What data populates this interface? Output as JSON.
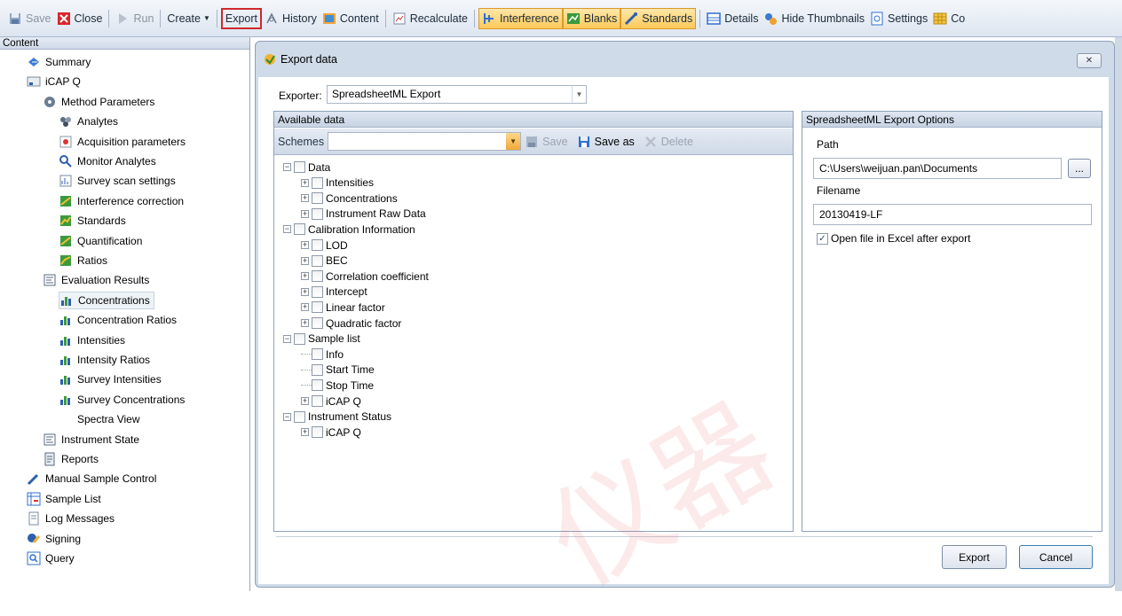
{
  "toolbar": {
    "save": "Save",
    "close": "Close",
    "run": "Run",
    "create": "Create",
    "export": "Export",
    "history": "History",
    "content": "Content",
    "recalculate": "Recalculate",
    "interference": "Interference",
    "blanks": "Blanks",
    "standards": "Standards",
    "details": "Details",
    "hide_thumbnails": "Hide Thumbnails",
    "settings": "Settings",
    "cut_off": "Co"
  },
  "left": {
    "header": "Content",
    "items": [
      {
        "label": "Summary",
        "icon": "summary-icon"
      },
      {
        "label": "iCAP Q",
        "icon": "instrument-icon"
      },
      {
        "label": "Method Parameters",
        "icon": "method-icon"
      },
      {
        "label": "Analytes",
        "icon": "analytes-icon"
      },
      {
        "label": "Acquisition parameters",
        "icon": "acquisition-icon"
      },
      {
        "label": "Monitor Analytes",
        "icon": "monitor-icon"
      },
      {
        "label": "Survey scan settings",
        "icon": "survey-icon"
      },
      {
        "label": "Interference correction",
        "icon": "interference-icon"
      },
      {
        "label": "Standards",
        "icon": "standards-icon"
      },
      {
        "label": "Quantification",
        "icon": "quantification-icon"
      },
      {
        "label": "Ratios",
        "icon": "ratios-icon"
      },
      {
        "label": "Evaluation Results",
        "icon": "evaluation-icon"
      },
      {
        "label": "Concentrations",
        "icon": "chart-icon"
      },
      {
        "label": "Concentration Ratios",
        "icon": "chart-icon"
      },
      {
        "label": "Intensities",
        "icon": "chart-icon"
      },
      {
        "label": "Intensity Ratios",
        "icon": "chart-icon"
      },
      {
        "label": "Survey Intensities",
        "icon": "chart-icon"
      },
      {
        "label": "Survey Concentrations",
        "icon": "chart-icon"
      },
      {
        "label": "Spectra View",
        "icon": ""
      },
      {
        "label": "Instrument State",
        "icon": "state-icon"
      },
      {
        "label": "Reports",
        "icon": "report-icon"
      },
      {
        "label": "Manual Sample Control",
        "icon": "pen-icon"
      },
      {
        "label": "Sample List",
        "icon": "samplelist-icon"
      },
      {
        "label": "Log Messages",
        "icon": "log-icon"
      },
      {
        "label": "Signing",
        "icon": "signing-icon"
      },
      {
        "label": "Query",
        "icon": "query-icon"
      }
    ]
  },
  "dialog": {
    "title": "Export data",
    "exporter_label": "Exporter:",
    "exporter_value": "SpreadsheetML Export",
    "available_header": "Available data",
    "schemes_label": "Schemes",
    "schemes_value": "",
    "save": "Save",
    "save_as": "Save as",
    "delete": "Delete",
    "tree": [
      {
        "label": "Data",
        "level": 0,
        "expander": "-"
      },
      {
        "label": "Intensities",
        "level": 1,
        "expander": "+"
      },
      {
        "label": "Concentrations",
        "level": 1,
        "expander": "+"
      },
      {
        "label": "Instrument Raw Data",
        "level": 1,
        "expander": "+"
      },
      {
        "label": "Calibration Information",
        "level": 0,
        "expander": "-"
      },
      {
        "label": "LOD",
        "level": 1,
        "expander": "+"
      },
      {
        "label": "BEC",
        "level": 1,
        "expander": "+"
      },
      {
        "label": "Correlation coefficient",
        "level": 1,
        "expander": "+"
      },
      {
        "label": "Intercept",
        "level": 1,
        "expander": "+"
      },
      {
        "label": "Linear factor",
        "level": 1,
        "expander": "+"
      },
      {
        "label": "Quadratic factor",
        "level": 1,
        "expander": "+"
      },
      {
        "label": "Sample list",
        "level": 0,
        "expander": "-"
      },
      {
        "label": "Info",
        "level": 1,
        "expander": ""
      },
      {
        "label": "Start Time",
        "level": 1,
        "expander": ""
      },
      {
        "label": "Stop Time",
        "level": 1,
        "expander": ""
      },
      {
        "label": "iCAP Q",
        "level": 1,
        "expander": "+"
      },
      {
        "label": "Instrument Status",
        "level": 0,
        "expander": "-"
      },
      {
        "label": "iCAP Q",
        "level": 1,
        "expander": "+"
      }
    ],
    "options_header": "SpreadsheetML Export Options",
    "path_label": "Path",
    "path_value": "C:\\Users\\weijuan.pan\\Documents",
    "browse": "...",
    "filename_label": "Filename",
    "filename_value": "20130419-LF",
    "open_excel": "Open file in Excel after export",
    "open_excel_checked": true,
    "export_btn": "Export",
    "cancel_btn": "Cancel"
  }
}
